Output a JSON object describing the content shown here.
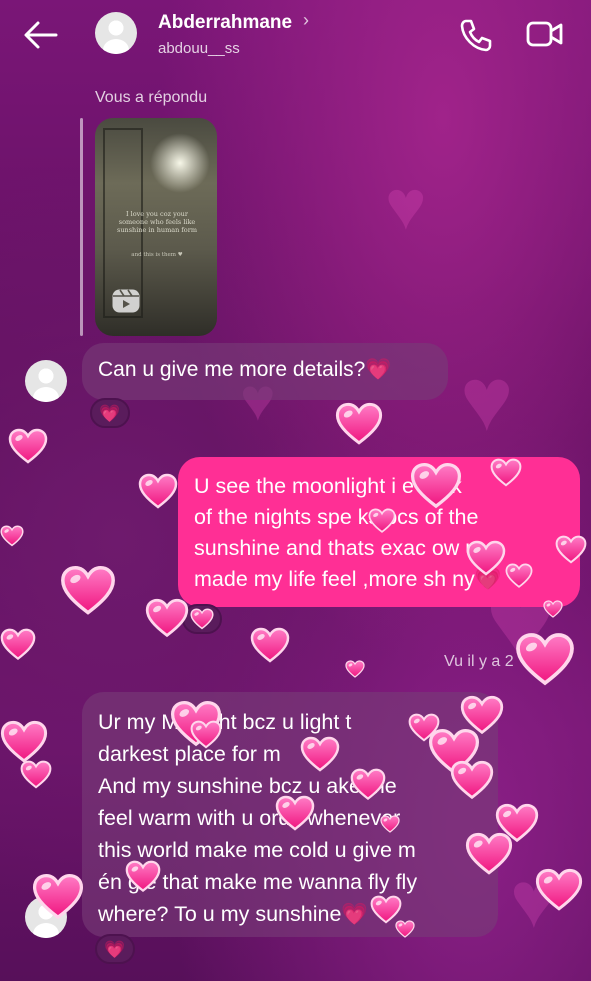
{
  "header": {
    "contact_name": "Abderrahmane",
    "chevron": "›",
    "contact_handle": "abdouu__ss",
    "icons": [
      "back-arrow-icon",
      "avatar",
      "phone-icon",
      "video-camera-icon"
    ]
  },
  "reply": {
    "label": "Vous a répondu",
    "reel_caption": "I love you coz your someone who feels like sunshine in human form",
    "reel_caption2": "and this is them ♥"
  },
  "messages": [
    {
      "direction": "incoming",
      "text": "Can u give me more details?💗",
      "reaction": "💗"
    },
    {
      "direction": "outgoing",
      "lines": [
        "U see the moonlight i e dark",
        "of the nights spe ks bcs of the",
        "sunshine and thats exac  ow u",
        "made my life feel ,more sh ny💗"
      ],
      "reaction": "💗"
    },
    {
      "direction": "incoming",
      "lines": [
        "Ur my M  nlight bcz u light t",
        "darkest place for m",
        "And my sunshine bcz u ake me",
        "feel warm with u  ords whenever",
        "this world make me cold u give m",
        "én  gie that make me wanna fly fly",
        "where? To u my sunshine💗"
      ],
      "reaction": "💗"
    }
  ],
  "seen_status": "Vu il y a 2",
  "colors": {
    "outgoing_bubble": "#ff2f95",
    "incoming_bubble": "#7a3c7a",
    "background": "#6b136a",
    "heart": "#ff3f9f"
  }
}
